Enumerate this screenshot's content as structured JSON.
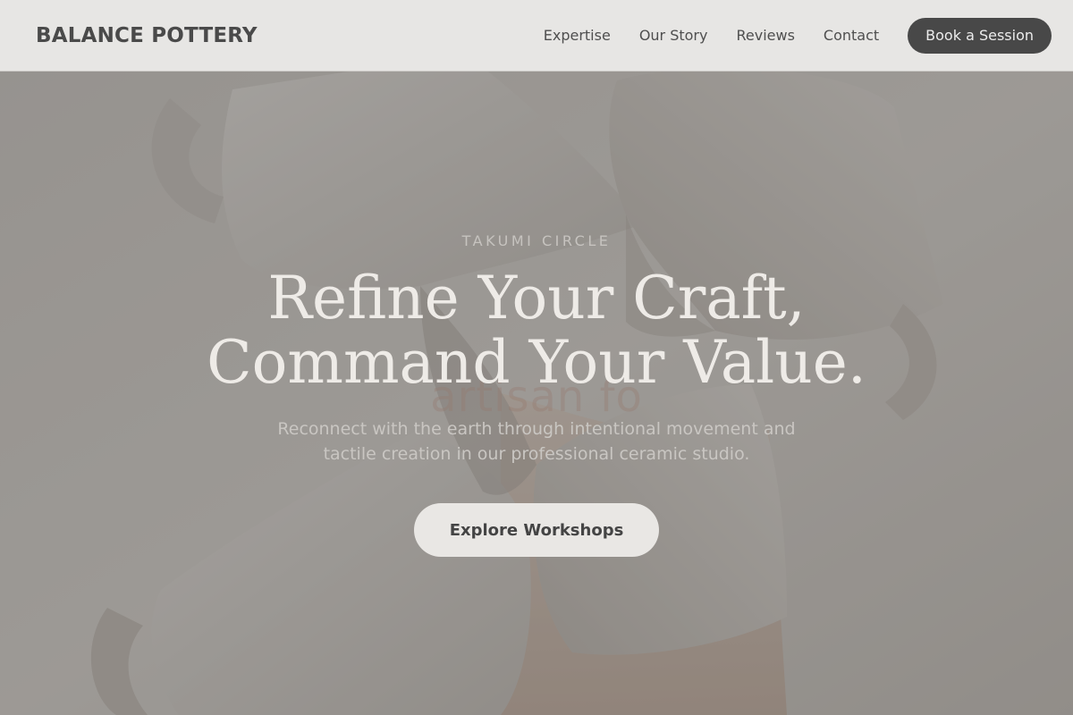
{
  "header": {
    "brand": "BALANCE POTTERY",
    "nav": [
      {
        "label": "Expertise"
      },
      {
        "label": "Our Story"
      },
      {
        "label": "Reviews"
      },
      {
        "label": "Contact"
      }
    ],
    "cta_label": "Book a Session"
  },
  "hero": {
    "eyebrow": "TAKUMI CIRCLE",
    "headline_line1": "Refine Your Craft,",
    "headline_line2": "Command Your Value.",
    "background_word": "artisan fo",
    "subtext": "Reconnect with the earth through intentional movement and tactile creation in our professional ceramic studio.",
    "button_label": "Explore Workshops",
    "background_image": "ceramic-mugs-photo"
  },
  "colors": {
    "header_bg": "#e7e6e4",
    "cta_bg": "#484848",
    "hero_overlay": "#3c3a38",
    "hero_text": "#eeebe7",
    "button_bg": "#e9e7e4"
  }
}
